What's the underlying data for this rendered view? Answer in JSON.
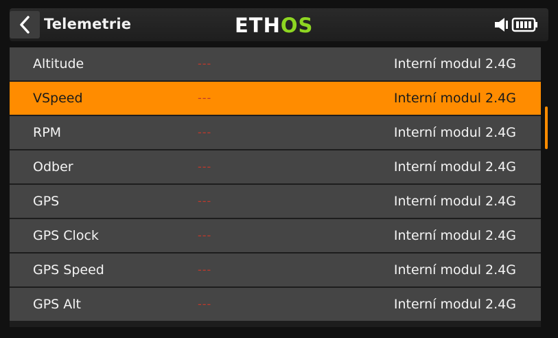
{
  "header": {
    "title": "Telemetrie",
    "logo_part1": "ETH",
    "logo_part2": "OS",
    "back_icon": "chevron-left-icon",
    "volume_icon": "speaker-icon",
    "battery_icon": "battery-icon"
  },
  "colors": {
    "accent": "#ff8c00",
    "logo_green": "#8ed622",
    "row_bg": "#454545",
    "value_red": "#c0392b"
  },
  "sensors": [
    {
      "name": "Altitude",
      "value": "---",
      "module": "Interní modul 2.4G"
    },
    {
      "name": "VSpeed",
      "value": "---",
      "module": "Interní modul 2.4G",
      "selected": true
    },
    {
      "name": "RPM",
      "value": "---",
      "module": "Interní modul 2.4G"
    },
    {
      "name": "Odber",
      "value": "---",
      "module": "Interní modul 2.4G"
    },
    {
      "name": "GPS",
      "value": "---",
      "module": "Interní modul 2.4G"
    },
    {
      "name": "GPS Clock",
      "value": "---",
      "module": "Interní modul 2.4G"
    },
    {
      "name": "GPS Speed",
      "value": "---",
      "module": "Interní modul 2.4G"
    },
    {
      "name": "GPS Alt",
      "value": "---",
      "module": "Interní modul 2.4G"
    }
  ]
}
